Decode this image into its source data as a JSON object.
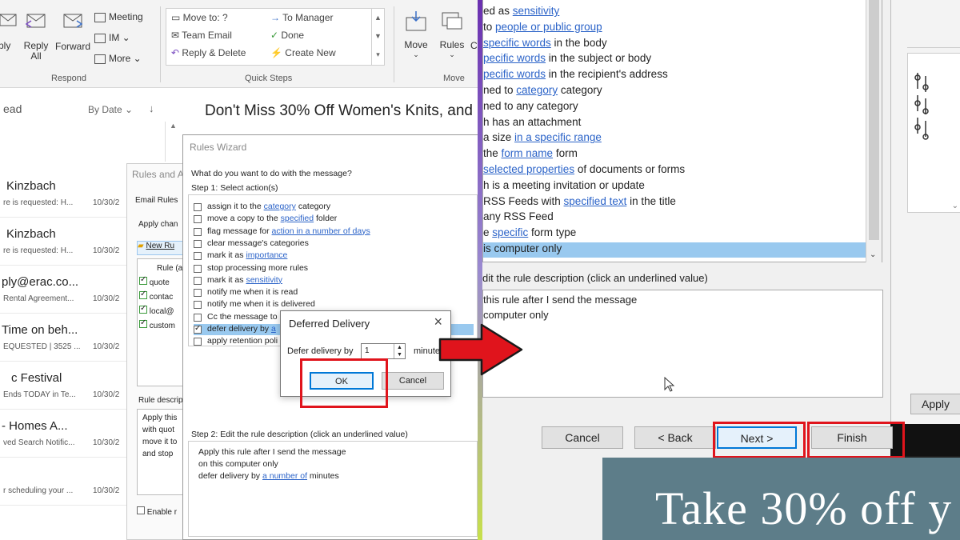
{
  "left": {
    "ribbon": {
      "reply": "ply",
      "reply_all": "Reply\nAll",
      "reply_all_l1": "Reply",
      "reply_all_l2": "All",
      "forward": "Forward",
      "meeting": "Meeting",
      "im": "IM ⌄",
      "more": "More ⌄",
      "respond_label": "Respond",
      "quick_steps": [
        "Move to: ?",
        "Team Email",
        "Reply & Delete",
        "To Manager",
        "Done",
        "Create New"
      ],
      "quick_steps_label": "Quick Steps",
      "move": "Move",
      "rules": "Rules",
      "move_label": "Move",
      "c_cut": "C"
    },
    "list_header": {
      "read": "ead",
      "sort": "By Date ⌄",
      "arrow": "↓"
    },
    "mail_items": [
      {
        "name": "Kinzbach",
        "sub": "re is requested: H...",
        "date": "10/30/2"
      },
      {
        "name": "Kinzbach",
        "sub": "re is requested: H...",
        "date": "10/30/2"
      },
      {
        "name": "ply@erac.co...",
        "sub": "Rental Agreement...",
        "date": "10/30/2"
      },
      {
        "name": "Time on beh...",
        "sub": "EQUESTED | 3525 ...",
        "date": "10/30/2"
      },
      {
        "name": "c Festival",
        "sub": "Ends TODAY in Te...",
        "date": "10/30/2"
      },
      {
        "name": "- Homes A...",
        "sub": "ved Search Notific...",
        "date": "10/30/2"
      },
      {
        "name": "",
        "sub": "r scheduling your ...",
        "date": "10/30/2"
      }
    ],
    "email_subject": "Don't Miss 30% Off Women's Knits, and",
    "rules_alerts": {
      "title": "Rules and A",
      "tab": "Email Rules",
      "apply": "Apply chan",
      "new_rule": "New Ru",
      "rule_col": "Rule (a",
      "rules": [
        "quote",
        "contac",
        "local@",
        "custom"
      ],
      "desc_label": "Rule descrip",
      "desc_lines": [
        "Apply this",
        "with quot",
        "move it to",
        "and stop"
      ],
      "enable": "Enable r"
    },
    "wizard": {
      "title": "Rules Wizard",
      "question": "What do you want to do with the message?",
      "step1": "Step 1: Select action(s)",
      "actions": [
        {
          "pre": "assign it to the ",
          "link": "category",
          "post": " category",
          "checked": false
        },
        {
          "pre": "move a copy to the ",
          "link": "specified",
          "post": " folder",
          "checked": false
        },
        {
          "pre": "flag message for ",
          "link": "action in a number of days",
          "post": "",
          "checked": false
        },
        {
          "pre": "clear message's categories",
          "link": "",
          "post": "",
          "checked": false
        },
        {
          "pre": "mark it as ",
          "link": "importance",
          "post": "",
          "checked": false
        },
        {
          "pre": "stop processing more rules",
          "link": "",
          "post": "",
          "checked": false
        },
        {
          "pre": "mark it as ",
          "link": "sensitivity",
          "post": "",
          "checked": false
        },
        {
          "pre": "notify me when it is read",
          "link": "",
          "post": "",
          "checked": false
        },
        {
          "pre": "notify me when it is delivered",
          "link": "",
          "post": "",
          "checked": false
        },
        {
          "pre": "Cc the message to",
          "link": "",
          "post": "",
          "checked": false
        },
        {
          "pre": "defer delivery by ",
          "link": "a",
          "post": "",
          "checked": true
        },
        {
          "pre": "apply retention poli",
          "link": "",
          "post": "",
          "checked": false
        }
      ],
      "step2": "Step 2: Edit the rule description (click an underlined value)",
      "desc": {
        "l1": "Apply this rule after I send the message",
        "l2": "on this computer only",
        "l3_pre": "defer delivery by ",
        "l3_link": "a number of",
        "l3_post": " minutes"
      }
    },
    "deferred": {
      "title": "Deferred Delivery",
      "label": "Defer delivery by",
      "value": "1",
      "unit": "minute",
      "ok": "OK",
      "cancel": "Cancel"
    }
  },
  "right": {
    "conditions": [
      {
        "pre": "ed as ",
        "link": "sensitivity",
        "post": ""
      },
      {
        "pre": "to ",
        "link": "people or public group",
        "post": ""
      },
      {
        "pre": "",
        "link": "specific words",
        "post": " in the body"
      },
      {
        "pre": "",
        "link": "pecific words",
        "post": " in the subject or body"
      },
      {
        "pre": "",
        "link": "pecific words",
        "post": " in the recipient's address"
      },
      {
        "pre": "ned to ",
        "link": "category",
        "post": " category"
      },
      {
        "pre": "ned to any category",
        "link": "",
        "post": ""
      },
      {
        "pre": "h has an attachment",
        "link": "",
        "post": ""
      },
      {
        "pre": "a size ",
        "link": "in a specific range",
        "post": ""
      },
      {
        "pre": "the ",
        "link": "form name",
        "post": " form"
      },
      {
        "pre": "",
        "link": "selected properties",
        "post": " of documents or forms"
      },
      {
        "pre": "h is a meeting invitation or update",
        "link": "",
        "post": ""
      },
      {
        "pre": "RSS Feeds with ",
        "link": "specified text",
        "post": " in the title"
      },
      {
        "pre": "any RSS Feed",
        "link": "",
        "post": ""
      },
      {
        "pre": "e ",
        "link": "specific",
        "post": " form type"
      },
      {
        "pre": "is computer only",
        "link": "",
        "post": ""
      }
    ],
    "edit_label": "dit the rule description (click an underlined value)",
    "desc_l1": "this rule after I send the message",
    "desc_l2": "computer only",
    "buttons": {
      "cancel": "Cancel",
      "back": "< Back",
      "next": "Next >",
      "finish": "Finish",
      "apply": "Apply"
    },
    "banner": "Take 30% off y"
  },
  "colors": {
    "highlight": "#99c9ef",
    "red": "#e0141c",
    "link": "#2b63c8"
  }
}
